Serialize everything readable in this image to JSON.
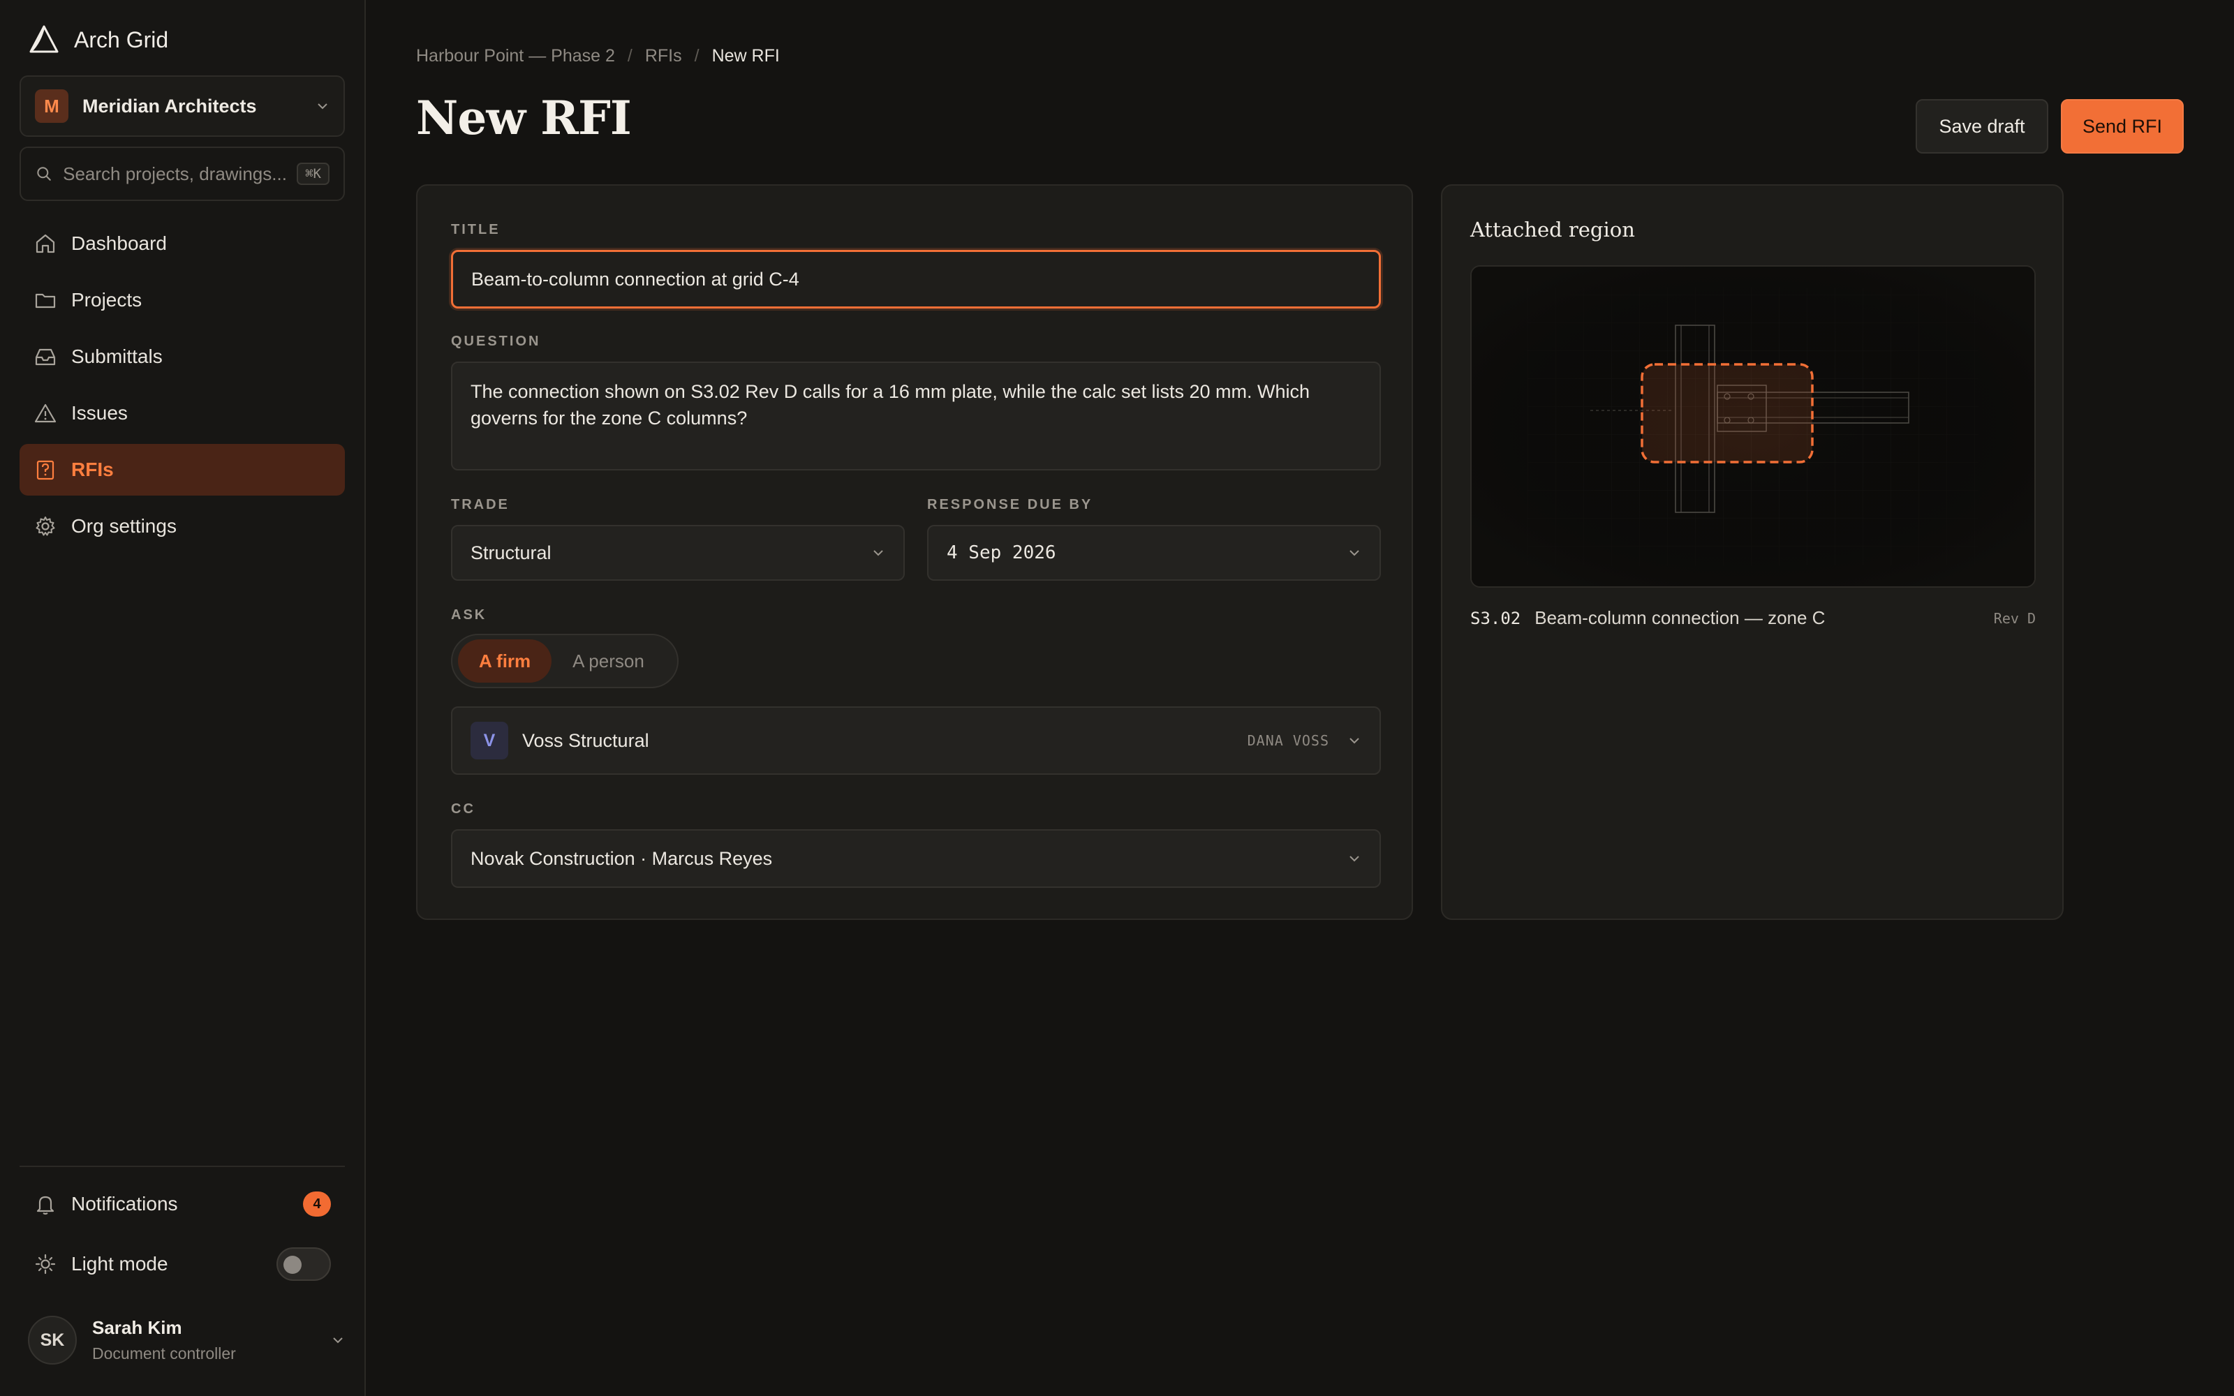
{
  "app": {
    "name": "Arch Grid"
  },
  "org": {
    "initial": "M",
    "name": "Meridian Architects"
  },
  "search": {
    "placeholder": "Search projects, drawings...",
    "shortcut": "⌘K"
  },
  "nav": {
    "items": [
      {
        "label": "Dashboard",
        "icon": "home-icon"
      },
      {
        "label": "Projects",
        "icon": "folder-icon"
      },
      {
        "label": "Submittals",
        "icon": "inbox-icon"
      },
      {
        "label": "Issues",
        "icon": "warning-icon"
      },
      {
        "label": "RFIs",
        "icon": "question-icon",
        "active": true
      },
      {
        "label": "Org settings",
        "icon": "gear-icon"
      }
    ]
  },
  "sidebar_bottom": {
    "notifications": {
      "label": "Notifications",
      "count": "4"
    },
    "light_mode": {
      "label": "Light mode",
      "on": false
    }
  },
  "user": {
    "initials": "SK",
    "name": "Sarah Kim",
    "role": "Document controller"
  },
  "breadcrumb": {
    "project": "Harbour Point — Phase 2",
    "section": "RFIs",
    "current": "New RFI",
    "separator": "/"
  },
  "page": {
    "title": "New RFI"
  },
  "actions": {
    "save_draft": "Save draft",
    "send": "Send RFI"
  },
  "form": {
    "title_label": "TITLE",
    "title_value": "Beam-to-column connection at grid C-4",
    "question_label": "QUESTION",
    "question_value": "The connection shown on S3.02 Rev D calls for a 16 mm plate, while the calc set lists 20 mm. Which governs for the zone C columns?",
    "trade_label": "TRADE",
    "trade_value": "Structural",
    "due_label": "RESPONSE DUE BY",
    "due_value": "4 Sep 2026",
    "ask_label": "ASK",
    "ask_options": [
      "A firm",
      "A person"
    ],
    "ask_selected": "A firm",
    "firm": {
      "initial": "V",
      "name": "Voss Structural",
      "contact": "DANA VOSS"
    },
    "cc_label": "CC",
    "cc_value": "Novak Construction · Marcus Reyes"
  },
  "attachment": {
    "title": "Attached region",
    "sheet": "S3.02",
    "description": "Beam-column connection — zone C",
    "revision": "Rev D"
  },
  "colors": {
    "accent": "#f26f36",
    "background": "#141311",
    "panel": "#1d1c19",
    "active_nav_bg": "#4a2416"
  }
}
